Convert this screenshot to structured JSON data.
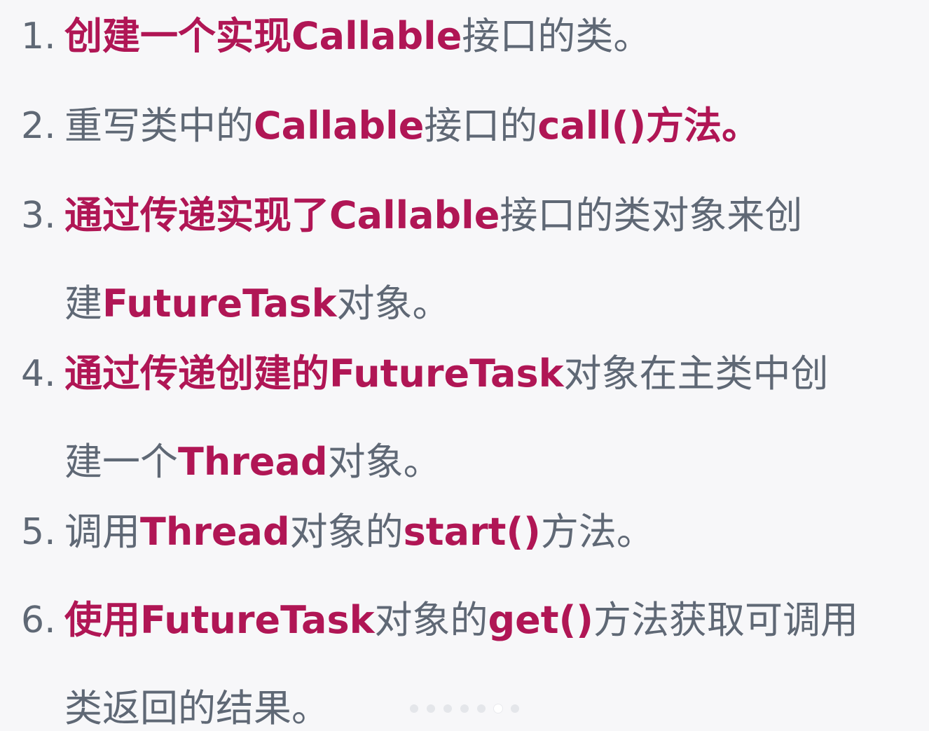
{
  "steps": [
    {
      "number": "1.",
      "lines": [
        [
          {
            "text": "创建一个实现Callable",
            "style": "em"
          },
          {
            "text": "接口的类。",
            "style": "norm"
          }
        ]
      ]
    },
    {
      "number": "2.",
      "lines": [
        [
          {
            "text": "重写类中的",
            "style": "norm"
          },
          {
            "text": "Callable",
            "style": "em"
          },
          {
            "text": "接口的",
            "style": "norm"
          },
          {
            "text": "call()方法。",
            "style": "em"
          }
        ]
      ]
    },
    {
      "number": "3.",
      "lines": [
        [
          {
            "text": "通过传递实现了Callable",
            "style": "em"
          },
          {
            "text": "接口的类对象来创",
            "style": "norm"
          }
        ],
        [
          {
            "text": "建",
            "style": "norm"
          },
          {
            "text": "FutureTask",
            "style": "em"
          },
          {
            "text": "对象。",
            "style": "norm"
          }
        ]
      ]
    },
    {
      "number": "4.",
      "lines": [
        [
          {
            "text": "通过传递创建的FutureTask",
            "style": "em"
          },
          {
            "text": "对象在主类中创",
            "style": "norm"
          }
        ],
        [
          {
            "text": "建一个",
            "style": "norm"
          },
          {
            "text": "Thread",
            "style": "em"
          },
          {
            "text": "对象。",
            "style": "norm"
          }
        ]
      ]
    },
    {
      "number": "5.",
      "lines": [
        [
          {
            "text": "调用",
            "style": "norm"
          },
          {
            "text": "Thread",
            "style": "em"
          },
          {
            "text": "对象的",
            "style": "norm"
          },
          {
            "text": "start()",
            "style": "em"
          },
          {
            "text": "方法。",
            "style": "norm"
          }
        ]
      ]
    },
    {
      "number": "6.",
      "lines": [
        [
          {
            "text": "使用FutureTask",
            "style": "em"
          },
          {
            "text": "对象的",
            "style": "norm"
          },
          {
            "text": "get()",
            "style": "em"
          },
          {
            "text": "方法获取可调用",
            "style": "norm"
          }
        ],
        [
          {
            "text": "类返回的结果。",
            "style": "norm"
          }
        ]
      ]
    }
  ],
  "pagination": {
    "count": 7,
    "active_index": 5
  },
  "colors": {
    "emphasis": "#b01655",
    "normal": "#5f6875",
    "background": "#f7f7f9"
  }
}
